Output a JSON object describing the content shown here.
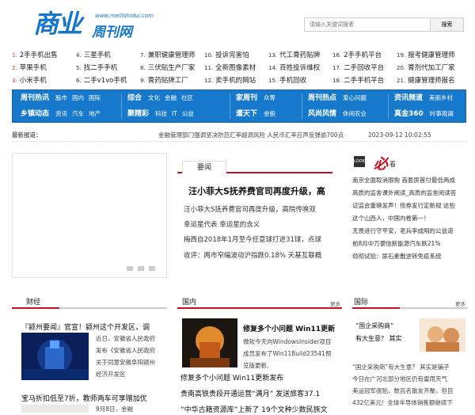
{
  "logo": {
    "main": "商业",
    "url": "www.meilishidui.com",
    "sub": "周刊网"
  },
  "search": {
    "placeholder": "请输入关键词搜索",
    "button": "搜索"
  },
  "hotlist": {
    "rows": [
      [
        {
          "n": "1.",
          "t": "2手手机出售"
        },
        {
          "n": "4.",
          "t": "三星手机"
        },
        {
          "n": "7.",
          "t": "兼职健康管理师"
        },
        {
          "n": "10.",
          "t": "投诉完害怕"
        },
        {
          "n": "13.",
          "t": "代工膏药贴牌"
        },
        {
          "n": "16.",
          "t": "2手手机平台"
        },
        {
          "n": "19.",
          "t": "报考健康管理师"
        }
      ],
      [
        {
          "n": "2.",
          "t": "苹果手机"
        },
        {
          "n": "5.",
          "t": "找二手手机"
        },
        {
          "n": "8.",
          "t": "三伏贴生产厂家"
        },
        {
          "n": "11.",
          "t": "全新图像素材"
        },
        {
          "n": "14.",
          "t": "百姓投诉维权"
        },
        {
          "n": "17.",
          "t": "二手回收平台"
        },
        {
          "n": "20.",
          "t": "膏剂代加工厂家"
        }
      ],
      [
        {
          "n": "3.",
          "t": "小米手机"
        },
        {
          "n": "6.",
          "t": "二手v1vo手机"
        },
        {
          "n": "9.",
          "t": "膏药贴牌工厂"
        },
        {
          "n": "12.",
          "t": "卖手机的网站"
        },
        {
          "n": "15.",
          "t": "手机回收"
        },
        {
          "n": "18.",
          "t": "二手手机平台"
        },
        {
          "n": "21.",
          "t": "健康管理师报名"
        }
      ]
    ]
  },
  "nav": {
    "groups": [
      {
        "l1": {
          "b": "周刊热讯",
          "s": [
            "股市",
            "国内",
            "国际"
          ]
        },
        "l2": {
          "b": "乡镇动态",
          "s": [
            "资讯",
            "汽车",
            "地产"
          ]
        }
      },
      {
        "l1": {
          "b": "综合",
          "s": [
            "文化",
            "金融",
            "社区"
          ]
        },
        "l2": {
          "b": "聚精彩",
          "s": [
            "科技",
            "IT",
            "公益"
          ]
        }
      },
      {
        "l1": {
          "b": "家周刊",
          "s": [
            "众筹"
          ]
        },
        "l2": {
          "b": "遭天下",
          "s": [
            "金股"
          ]
        }
      },
      {
        "l1": {
          "b": "周刊热点",
          "s": [
            "爱心问题"
          ]
        },
        "l2": {
          "b": "风尚风情",
          "s": [
            "休闲农业"
          ]
        }
      },
      {
        "l1": {
          "b": "资讯频道",
          "s": [
            "美丽乡村"
          ]
        },
        "l2": {
          "b": "真金360",
          "s": [
            "时事观澜"
          ]
        }
      }
    ]
  },
  "newsbar": {
    "label": "最新报道：",
    "text": "金融管理部门强调坚决防范汇率超调风险 人民币汇率应声反弹逾700点",
    "time": "2023-09-12 10:02:55"
  },
  "yaowen": {
    "tab": "要闻",
    "headline": "汪小菲大S抚养费官司再度升级，高",
    "items": [
      "汪小菲大S抚养费官司再度升级，高院传唤双",
      "幸运星代表 幸运星的含义",
      "梅西自2018年1月至今任意球打进31球，点球",
      "收评：两市窄幅波动沪指跌0.18% 天基互联概"
    ]
  },
  "look": {
    "badge": "LOOK",
    "bi": "必",
    "kan": "看",
    "lines": [
      "南京全面取消限购 首套房首付最低两成",
      "高质的监舍课外阅读_高质的监舍阅读答",
      "证监会重磅发声！债券发行定新规 这些",
      "这个山西人，中国内卷第一！",
      "无畏进行守平安，老兵李成明的公益道",
      "前8月中万豪信新能源汽车跌21%",
      "劲彻试验：尿石素敷逆转免疫系统"
    ]
  },
  "caijing": {
    "title": "财经",
    "lead": "『颍州要闻』官宣！颍州这个开发区，调",
    "body": [
      "近日，安徽省人民政府",
      "发布《安徽省人民政府",
      "关于同意安徽阜阳颍州",
      "经济开发区"
    ],
    "second": "宝马折扣低至7折，教师两车可享赠加优",
    "sub": "9月8日，金融"
  },
  "guonei": {
    "title": "国内",
    "more": "更多",
    "lead": "修复多个小问题 Win11更新",
    "body": [
      "微软今天向WindowsInsider项目",
      "成员发布了Win11Build23541预",
      "览版更新,"
    ],
    "items": [
      "修复多个小问题 Win11更新发布",
      "贵南高铁贵段开通运营“满月” 发送旅客37.1",
      "“中华古籍资源库”上新了 19个文种少数民族文"
    ]
  },
  "guoji": {
    "title": "国际",
    "more": "更多",
    "lead_a": "“国企采购商”",
    "lead_b": "有大生意？ 其实",
    "body": [
      "“国企采购商”有大生意？ 其实是骗子",
      "今日在广河北部分地区仍有雷雨天气",
      "美运冠军很贴，数百名散友齐聚，但目",
      "432亿美元！全球半导体销售额继续下"
    ]
  },
  "colors": {
    "brand": "#1676c9",
    "nav": "#1679cc",
    "accent": "#c8101e"
  }
}
